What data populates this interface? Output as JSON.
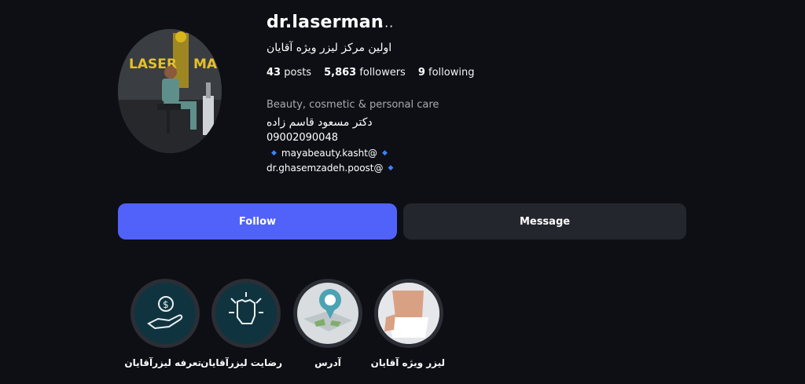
{
  "profile": {
    "username": "dr.laserman",
    "more_icon": "···",
    "full_name": "اولین مرکز لیزر ویژه آقایان",
    "stats": {
      "posts_count": "43",
      "posts_label": "posts",
      "followers_count": "5,863",
      "followers_label": "followers",
      "following_count": "9",
      "following_label": "following"
    },
    "category": "Beauty, cosmetic & personal care",
    "bio": {
      "name": "دکتر مسعود قاسم زاده",
      "phone": "09002090048",
      "link1": "mayabeauty.kasht@",
      "link2": "dr.ghasemzadeh.poost@"
    },
    "avatar_text_left": "LASER",
    "avatar_text_right": "MAN"
  },
  "actions": {
    "follow_label": "Follow",
    "message_label": "Message"
  },
  "highlights": [
    {
      "label": "تعرفه لیزرآقایان",
      "icon": "price-hand-icon"
    },
    {
      "label": "رضایت لیزرآقایان",
      "icon": "fist-icon"
    },
    {
      "label": "آدرس",
      "icon": "map-pin-icon"
    },
    {
      "label": "لیزر ویژه آقایان",
      "icon": "photo"
    }
  ],
  "colors": {
    "background": "#0d0f14",
    "follow_button": "#5162fb",
    "message_button": "#23262c",
    "diamond": "#3b82f6"
  }
}
